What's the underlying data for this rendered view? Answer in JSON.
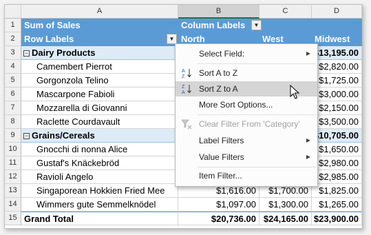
{
  "columns": [
    "A",
    "B",
    "C",
    "D"
  ],
  "pivot": {
    "sum_label": "Sum of Sales",
    "column_labels": "Column Labels",
    "row_labels": "Row Labels",
    "col_b_header": "North",
    "col_c_header": "West",
    "col_d_header": "Midwest"
  },
  "rows": [
    {
      "n": "3",
      "label": "Dairy Products",
      "type": "group",
      "d": "$13,195.00"
    },
    {
      "n": "4",
      "label": "Camembert Pierrot",
      "type": "item",
      "d": "$2,820.00"
    },
    {
      "n": "5",
      "label": "Gorgonzola Telino",
      "type": "item",
      "d": "$1,725.00"
    },
    {
      "n": "6",
      "label": "Mascarpone Fabioli",
      "type": "item",
      "d": "$3,000.00"
    },
    {
      "n": "7",
      "label": "Mozzarella di Giovanni",
      "type": "item",
      "d": "$2,150.00"
    },
    {
      "n": "8",
      "label": "Raclette Courdavault",
      "type": "item",
      "d": "$3,500.00"
    },
    {
      "n": "9",
      "label": "Grains/Cereals",
      "type": "group",
      "d": "$10,705.00"
    },
    {
      "n": "10",
      "label": "Gnocchi di nonna Alice",
      "type": "item",
      "d": "$1,650.00"
    },
    {
      "n": "11",
      "label": "Gustaf's Knäckebröd",
      "type": "item",
      "d": "$2,980.00"
    },
    {
      "n": "12",
      "label": "Ravioli Angelo",
      "type": "item",
      "d": "$2,985.00"
    },
    {
      "n": "13",
      "label": "Singaporean Hokkien Fried Mee",
      "type": "item",
      "b": "$1,616.00",
      "c": "$1,700.00",
      "d": "$1,825.00"
    },
    {
      "n": "14",
      "label": "Wimmers gute Semmelknödel",
      "type": "item",
      "b": "$1,097.00",
      "c": "$1,300.00",
      "d": "$1,265.00"
    },
    {
      "n": "15",
      "label": "Grand Total",
      "type": "total",
      "b": "$20,736.00",
      "c": "$24,165.00",
      "d": "$23,900.00"
    }
  ],
  "menu": {
    "items": [
      {
        "label": "Select Field:",
        "submenu": true
      },
      {
        "label": "Sort A to Z",
        "icon": "sort-az-icon"
      },
      {
        "label": "Sort Z to A",
        "icon": "sort-za-icon",
        "highlighted": true
      },
      {
        "label": "More Sort Options..."
      },
      {
        "label": "Clear Filter From 'Category'",
        "icon": "clear-filter-icon",
        "disabled": true
      },
      {
        "label": "Label Filters",
        "submenu": true
      },
      {
        "label": "Value Filters",
        "submenu": true
      },
      {
        "label": "Item Filter..."
      }
    ]
  },
  "colors": {
    "header_blue": "#5b9bd5",
    "group_band": "#ddebf7",
    "menu_highlight": "#d5d5d5"
  }
}
